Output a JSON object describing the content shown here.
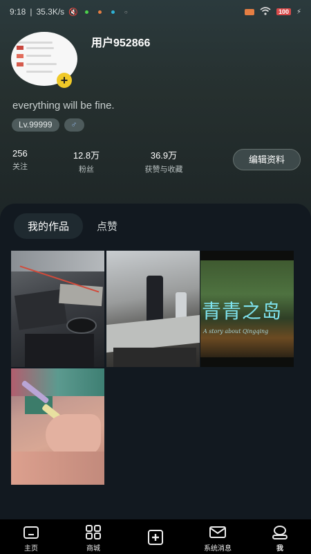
{
  "status_bar": {
    "time": "9:18",
    "net_speed": "35.3K/s",
    "battery": "100",
    "dot_colors": [
      "#4bd14b",
      "#e57e43",
      "#2fb3d6"
    ]
  },
  "profile": {
    "username": "用户952866",
    "bio": "everything will be fine.",
    "level_tag": "Lv.99999",
    "gender_icon": "♂",
    "add_icon": "+"
  },
  "stats": [
    {
      "value": "256",
      "label": "关注"
    },
    {
      "value": "12.8万",
      "label": "粉丝"
    },
    {
      "value": "36.9万",
      "label": "获赞与收藏"
    }
  ],
  "edit_button": "编辑资料",
  "tabs": [
    {
      "label": "我的作品",
      "active": true
    },
    {
      "label": "点赞",
      "active": false
    }
  ],
  "works": {
    "video3_title": "青青之岛",
    "video3_subtitle": "A story about Qingqing"
  },
  "bottom_nav": [
    {
      "label": "主页",
      "icon": "home-icon"
    },
    {
      "label": "商城",
      "icon": "grid-icon"
    },
    {
      "label": "",
      "icon": "add-icon"
    },
    {
      "label": "系统消息",
      "icon": "mail-icon"
    },
    {
      "label": "我",
      "icon": "profile-icon"
    }
  ],
  "colors": {
    "accent_yellow": "#f0c928",
    "panel_bg": "#121920",
    "nav_bg": "#000000"
  }
}
